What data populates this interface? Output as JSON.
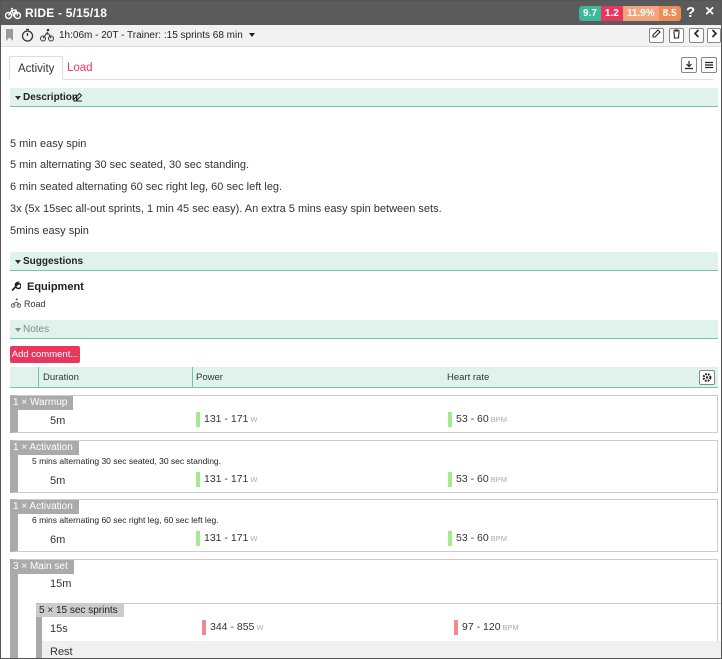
{
  "window": {
    "title": "RIDE - 5/15/18",
    "help": "?",
    "close": "×"
  },
  "metrics": [
    {
      "value": "9.7",
      "color": "#3db897"
    },
    {
      "value": "1.2",
      "color": "#e8375f"
    },
    {
      "value": "11.9%",
      "color": "#f2a47f"
    },
    {
      "value": "8.5",
      "color": "#ee8c57"
    }
  ],
  "toolbar": {
    "info": "1h:06m - 20T - Trainer: :15 sprints 68 min"
  },
  "tabs": [
    "Activity",
    "Load"
  ],
  "sections": {
    "description": "Description",
    "suggestions": "Suggestions",
    "notes": "Notes"
  },
  "description": [
    "5 min easy spin",
    "5 min alternating 30 sec seated, 30 sec standing.",
    "6 min seated alternating 60 sec right leg, 60 sec left leg.",
    "3x (5x 15sec all-out sprints, 1 min 45 sec easy). An extra 5 mins easy spin between sets.",
    "5mins easy spin"
  ],
  "equipment": {
    "title": "Equipment",
    "item": "Road"
  },
  "add_comment": "Add comment...",
  "table": {
    "cols": [
      "Duration",
      "Power",
      "Heart rate"
    ]
  },
  "units": {
    "power": "W",
    "hr": "BPM"
  },
  "steps": [
    {
      "label": "1 × Warmup",
      "note": "",
      "duration": "5m",
      "power": "131 - 171",
      "hr": "53 - 60"
    },
    {
      "label": "1 × Activation",
      "note": "5 mins alternating 30 sec seated, 30 sec standing.",
      "duration": "5m",
      "power": "131 - 171",
      "hr": "53 - 60"
    },
    {
      "label": "1 × Activation",
      "note": "6 mins alternating 60 sec right leg, 60 sec left leg.",
      "duration": "6m",
      "power": "131 - 171",
      "hr": "53 - 60"
    }
  ],
  "mainset": {
    "label": "3 × Main set",
    "duration": "15m",
    "sub": {
      "label": "5 × 15 sec sprints",
      "duration": "15s",
      "power": "344 - 855",
      "hr": "97 - 120",
      "rest": "Rest"
    }
  },
  "colors": {
    "zone_green": "#a4ea8e",
    "zone_red": "#ef8a8f",
    "accent": "#e8375f"
  }
}
